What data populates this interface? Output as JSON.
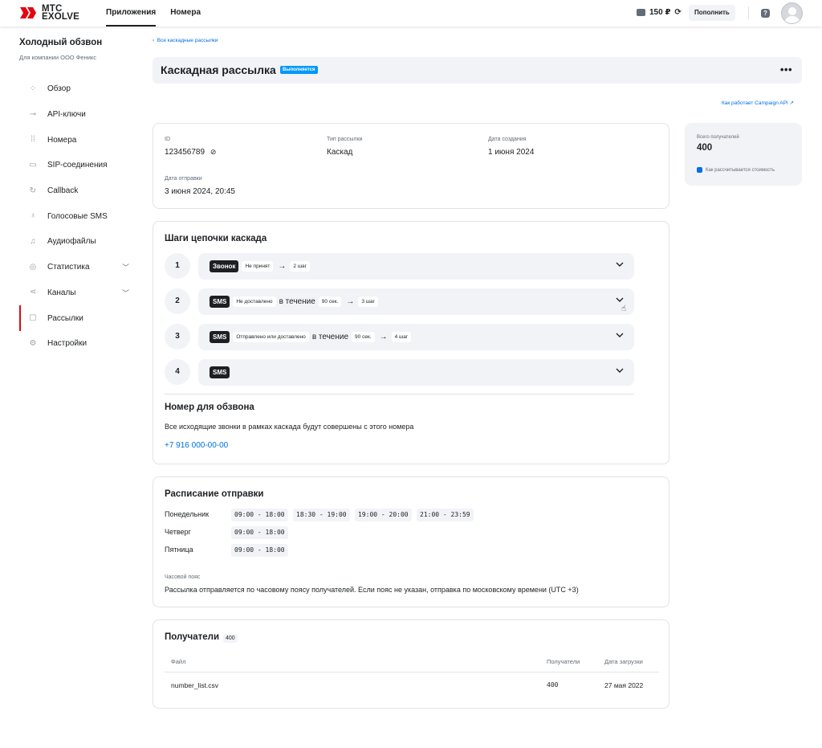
{
  "topbar": {
    "logo_line1": "МТС",
    "logo_line2": "EXOLVE",
    "nav": [
      "Приложения",
      "Номера"
    ],
    "balance": "150 ₽",
    "topup_label": "Пополнить",
    "help_icon": "question-icon",
    "colors": {
      "brand": "#e30611",
      "link": "#0070e5",
      "status": "#0097fd"
    }
  },
  "sidebar": {
    "title": "Холодный обзвон",
    "subtitle": "Для компании ООО Феникс",
    "items": [
      {
        "label": "Обзор",
        "icon": "grid-icon"
      },
      {
        "label": "API-ключи",
        "icon": "key-icon"
      },
      {
        "label": "Номера",
        "icon": "dialpad-icon"
      },
      {
        "label": "SIP-соединения",
        "icon": "sip-icon"
      },
      {
        "label": "Callback",
        "icon": "callback-icon"
      },
      {
        "label": "Голосовые SMS",
        "icon": "mic-icon"
      },
      {
        "label": "Аудиофайлы",
        "icon": "music-icon"
      },
      {
        "label": "Статистика",
        "icon": "chart-icon"
      },
      {
        "label": "Каналы",
        "icon": "channels-icon"
      },
      {
        "label": "Рассылки",
        "icon": "mailing-icon"
      },
      {
        "label": "Настройки",
        "icon": "settings-icon"
      }
    ]
  },
  "breadcrumb": "Все каскадные рассылки",
  "header": {
    "title": "Каскадная рассылка",
    "status": "Выполняется",
    "more": "•••"
  },
  "api_link": "Как работает Campaign API",
  "info": {
    "id_label": "ID",
    "id_value": "123456789",
    "type_label": "Тип рассылки",
    "type_value": "Каскад",
    "created_label": "Дата создания",
    "created_value": "1 июня 2024",
    "sent_label": "Дата отправки",
    "sent_value": "3 июня 2024,  20:45"
  },
  "total": {
    "label": "Всего получателей",
    "value": "400",
    "cost_link": "Как рассчитывается стоимость"
  },
  "steps": {
    "title": "Шаги цепочки каскада",
    "items": [
      {
        "num": "1",
        "channel": "Звонок",
        "condition": "Не принят",
        "next": "2 шаг"
      },
      {
        "num": "2",
        "channel": "SMS",
        "condition": "Не доставлено",
        "within": "в течение",
        "timeout": "90 сек.",
        "next": "3 шаг"
      },
      {
        "num": "3",
        "channel": "SMS",
        "condition": "Отправлено или доставлено",
        "within": "в течение",
        "timeout": "90 сек.",
        "next": "4 шаг"
      },
      {
        "num": "4",
        "channel": "SMS"
      }
    ],
    "number_title": "Номер для обзвона",
    "number_desc": "Все исходящие звонки в рамках каскада будут совершены с этого номера",
    "number": "+7 916 000-00-00"
  },
  "schedule": {
    "title": "Расписание отправки",
    "rows": [
      {
        "day": "Понедельник",
        "times": [
          "09:00 - 18:00",
          "18:30 - 19:00",
          "19:00 - 20:00",
          "21:00 - 23:59"
        ]
      },
      {
        "day": "Четверг",
        "times": [
          "09:00 - 18:00"
        ]
      },
      {
        "day": "Пятница",
        "times": [
          "09:00 - 18:00"
        ]
      }
    ],
    "tz_label": "Часовой пояс",
    "tz_text": "Рассылка отправляется по часовому поясу получателей. Если пояс не указан, отправка по московскому времени (UTC +3)"
  },
  "recipients": {
    "title": "Получатели",
    "count": "400",
    "columns": [
      "Файл",
      "Получатели",
      "Дата загрузки"
    ],
    "rows": [
      {
        "file": "number_list.csv",
        "count": "400",
        "date": "27 мая 2022"
      }
    ]
  }
}
